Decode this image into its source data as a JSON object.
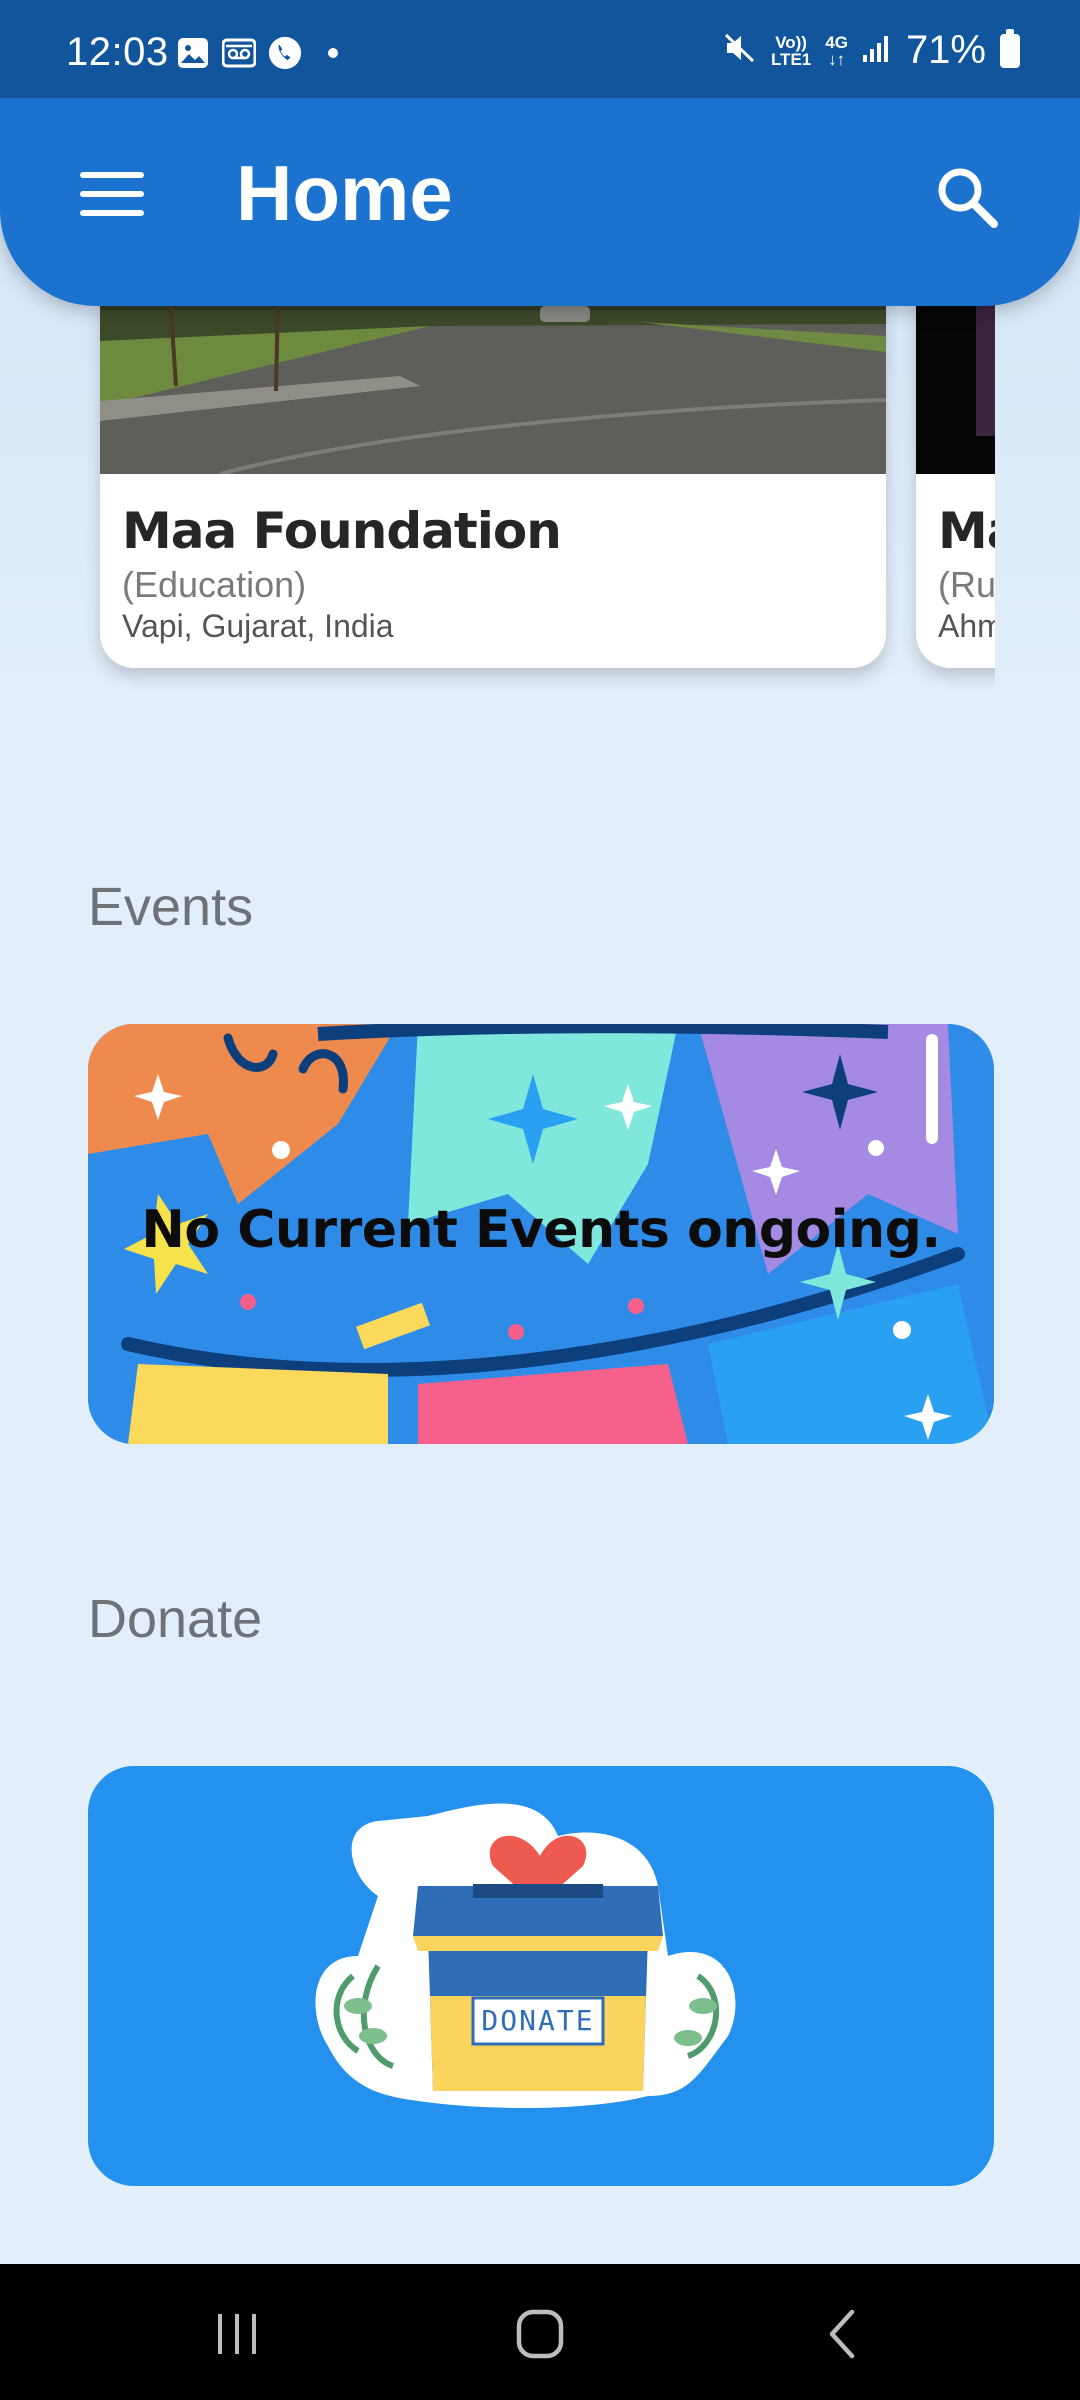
{
  "status_bar": {
    "time": "12:03",
    "network_top": "Vo))",
    "network_bottom": "LTE1",
    "net_type": "4G",
    "battery": "71%"
  },
  "app_bar": {
    "title": "Home",
    "menu_icon": "hamburger-menu-icon",
    "search_icon": "search-icon"
  },
  "organizations": [
    {
      "name": "Maa Foundation",
      "category": "(Education)",
      "location": "Vapi, Gujarat, India"
    },
    {
      "name": "Ma",
      "category": "(Ru",
      "location": "Ahm"
    }
  ],
  "events": {
    "title": "Events",
    "message": "No Current Events ongoing."
  },
  "donate": {
    "title": "Donate",
    "box_label": "DONATE"
  },
  "colors": {
    "status_bar": "#11569c",
    "app_bar": "#1b73cf",
    "events_bg": "#2e8ce8",
    "donate_bg": "#2491ef"
  }
}
